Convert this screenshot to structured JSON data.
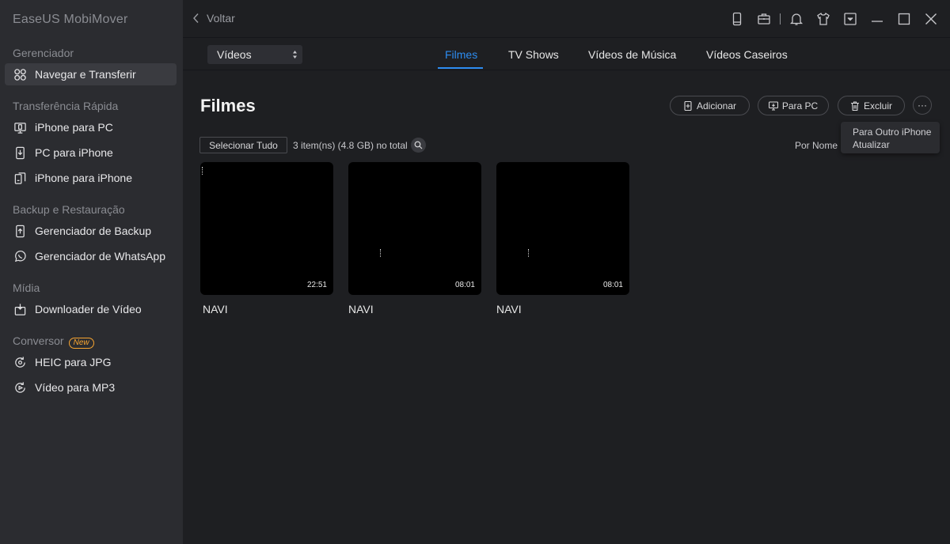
{
  "app": {
    "title": "EaseUS MobiMover"
  },
  "sidebar": {
    "sections": [
      {
        "label": "Gerenciador"
      },
      {
        "label": "Transferência Rápida"
      },
      {
        "label": "Backup e Restauração"
      },
      {
        "label": "Mídia"
      },
      {
        "label": "Conversor",
        "badge": "New"
      }
    ],
    "items": [
      {
        "label": "Navegar e Transferir",
        "icon": "grid-icon",
        "active": true
      },
      {
        "label": "iPhone para PC",
        "icon": "phone-to-pc-icon"
      },
      {
        "label": "PC para iPhone",
        "icon": "pc-to-phone-icon"
      },
      {
        "label": "iPhone para iPhone",
        "icon": "phone-to-phone-icon"
      },
      {
        "label": "Gerenciador de Backup",
        "icon": "backup-icon"
      },
      {
        "label": "Gerenciador de WhatsApp",
        "icon": "whatsapp-icon"
      },
      {
        "label": "Downloader de Vídeo",
        "icon": "download-icon"
      },
      {
        "label": "HEIC para JPG",
        "icon": "convert-image-icon"
      },
      {
        "label": "Vídeo para MP3",
        "icon": "convert-audio-icon"
      }
    ]
  },
  "topbar": {
    "back_label": "Voltar"
  },
  "category": {
    "selected": "Vídeos"
  },
  "tabs": [
    {
      "label": "Filmes",
      "active": true
    },
    {
      "label": "TV Shows"
    },
    {
      "label": "Vídeos de Música"
    },
    {
      "label": "Vídeos Caseiros"
    }
  ],
  "content": {
    "title": "Filmes",
    "add_label": "Adicionar",
    "topc_label": "Para PC",
    "delete_label": "Excluir",
    "more_label": "···",
    "select_all_label": "Selecionar Tudo",
    "count_text": "3 item(ns) (4.8 GB) no total",
    "sort_label": "Por Nome"
  },
  "dropdown": {
    "items": [
      "Para Outro iPhone",
      "Atualizar"
    ]
  },
  "videos": [
    {
      "title": "NAVI",
      "duration": "22:51"
    },
    {
      "title": "NAVI",
      "duration": "08:01"
    },
    {
      "title": "NAVI",
      "duration": "08:01"
    }
  ],
  "colors": {
    "accent": "#2d8cf0",
    "badge": "#f7a531",
    "sidebar_bg": "#2b2c30",
    "main_bg": "#1e1f22"
  }
}
